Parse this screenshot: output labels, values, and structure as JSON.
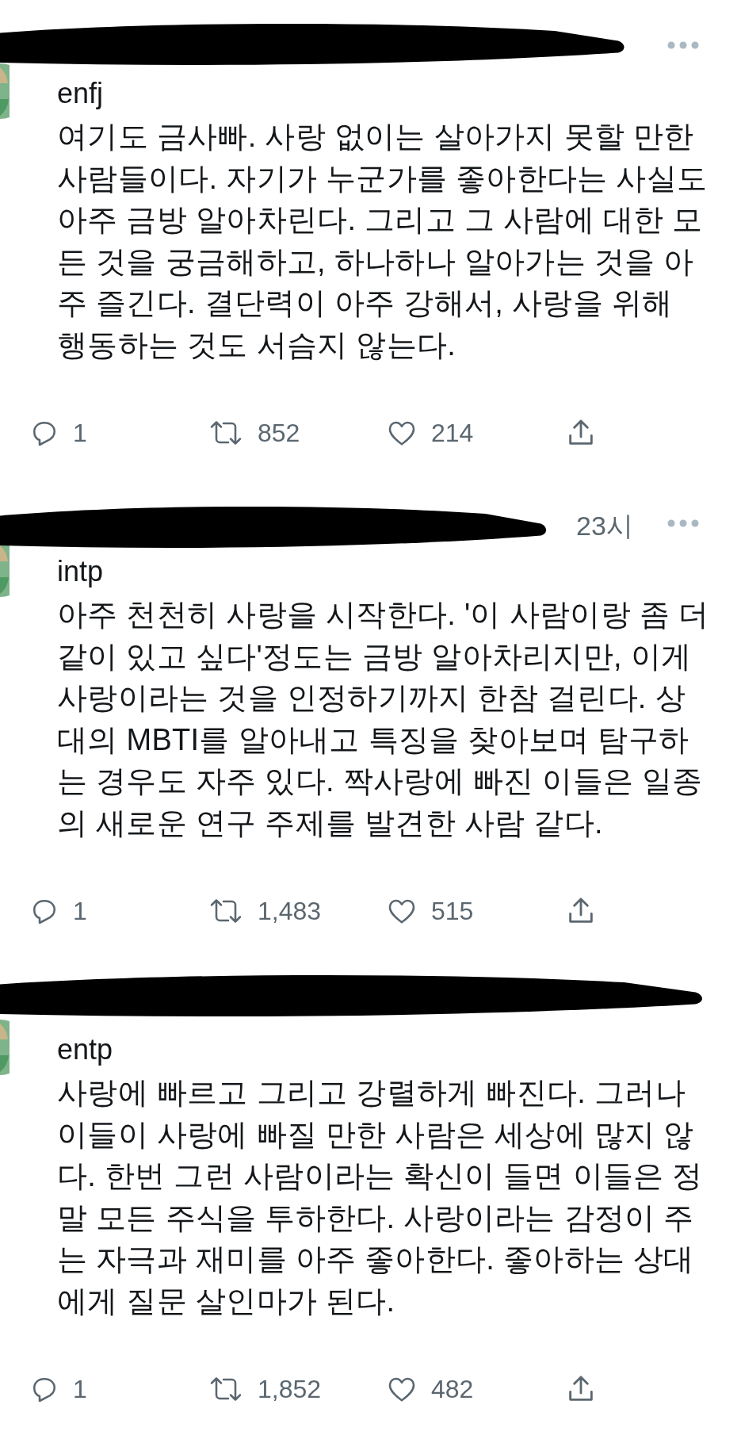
{
  "tweets": [
    {
      "more_menu": true,
      "name": "enfj",
      "text": "여기도 금사빠. 사랑 없이는 살아가지 못할 만한 사람들이다. 자기가 누군가를 좋아한다는 사실도 아주 금방 알아차린다. 그리고 그 사람에 대한 모든 것을 궁금해하고, 하나하나 알아가는 것을 아주 즐긴다. 결단력이 아주 강해서, 사랑을 위해 행동하는 것도 서슴지 않는다.",
      "replies": "1",
      "retweets": "852",
      "likes": "214"
    },
    {
      "time": "23시",
      "more_menu": true,
      "name": "intp",
      "text": "아주 천천히 사랑을 시작한다. '이 사람이랑 좀 더 같이 있고 싶다'정도는 금방 알아차리지만, 이게 사랑이라는 것을 인정하기까지 한참 걸린다. 상대의 MBTI를 알아내고 특징을 찾아보며 탐구하는 경우도 자주 있다. 짝사랑에 빠진 이들은 일종의 새로운 연구 주제를 발견한 사람 같다.",
      "replies": "1",
      "retweets": "1,483",
      "likes": "515"
    },
    {
      "name": "entp",
      "text": "사랑에 빠르고 그리고 강렬하게 빠진다. 그러나 이들이 사랑에 빠질 만한 사람은 세상에 많지 않다. 한번 그런 사람이라는 확신이 들면 이들은 정말 모든 주식을 투하한다. 사랑이라는 감정이 주는 자극과 재미를 아주 좋아한다. 좋아하는 상대에게 질문 살인마가 된다.",
      "replies": "1",
      "retweets": "1,852",
      "likes": "482"
    }
  ]
}
